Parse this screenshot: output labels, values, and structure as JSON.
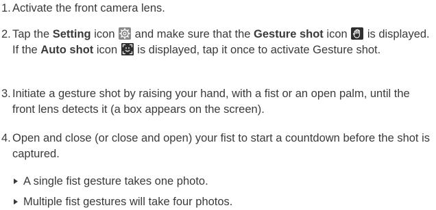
{
  "steps": [
    {
      "num": "1.",
      "text": "Activate the front camera lens."
    },
    {
      "num": "2.",
      "t1": "Tap the ",
      "b1": "Setting",
      "t2": " icon ",
      "t3": " and make sure that the ",
      "b2": "Gesture shot",
      "t4": " icon ",
      "t5": " is displayed. If the ",
      "b3": "Auto shot",
      "t6": " icon ",
      "t7": " is displayed, tap it once to activate Gesture shot."
    },
    {
      "num": "3.",
      "text": "Initiate a gesture shot by raising your hand, with a fist or an open palm, until the front lens detects it (a box appears on the screen)."
    },
    {
      "num": "4.",
      "text": "Open and close (or close and open) your fist to start a countdown before the shot is captured."
    }
  ],
  "bullets": [
    "A single fist gesture takes one photo.",
    "Multiple fist gestures will take four photos."
  ],
  "icons": {
    "setting": "gear-icon",
    "gesture_shot": "hand-palm-icon",
    "auto_shot": "face-frame-icon"
  }
}
